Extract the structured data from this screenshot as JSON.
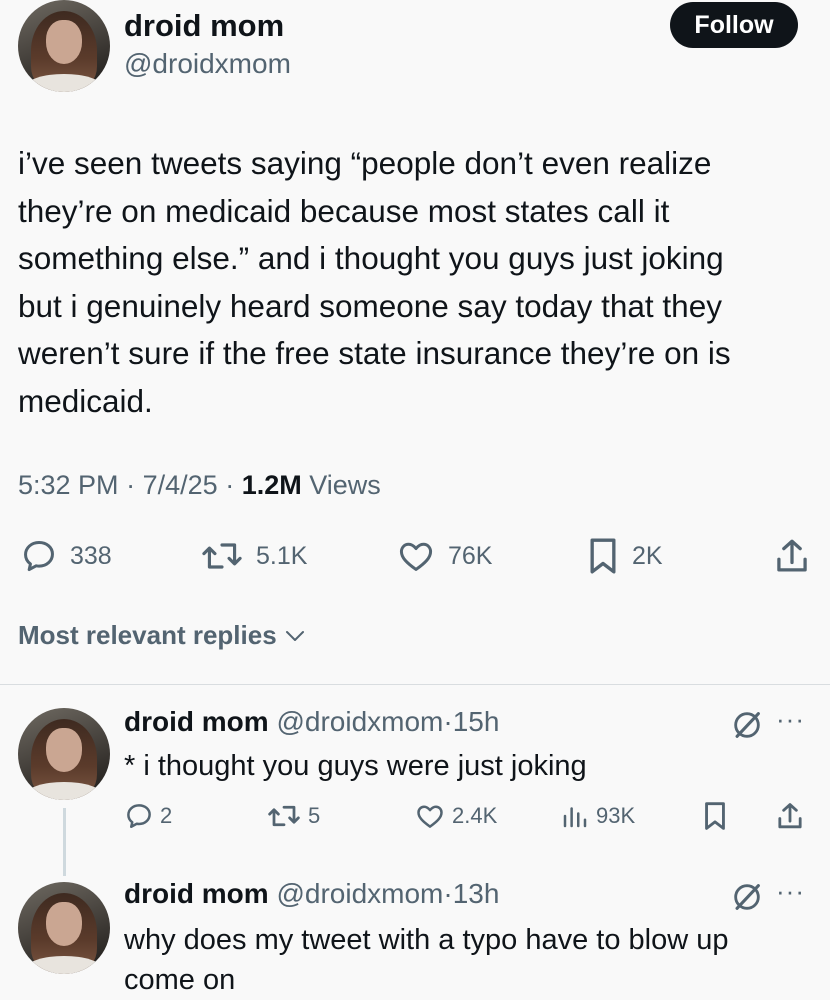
{
  "tweet": {
    "author": {
      "name": "droid mom",
      "handle": "@droidxmom"
    },
    "follow_label": "Follow",
    "text_lines": [
      "i’ve seen tweets saying “people don’t even realize",
      "they’re on medicaid because most states call it",
      "something else.” and i thought you guys just joking",
      "but i genuinely heard someone say today that they",
      "weren’t sure if the free state insurance they’re on is",
      "medicaid."
    ],
    "time": "5:32 PM",
    "date": "7/4/25",
    "sep": "·",
    "views_count": "1.2M",
    "views_label": "Views",
    "stats": {
      "replies": "338",
      "reposts": "5.1K",
      "likes": "76K",
      "bookmarks": "2K"
    }
  },
  "replies_header": "Most relevant replies",
  "replies": [
    {
      "name": "droid mom",
      "handle": "@droidxmom",
      "time": "15h",
      "text": "* i thought you guys were just joking",
      "stats": {
        "replies": "2",
        "reposts": "5",
        "likes": "2.4K",
        "views": "93K"
      }
    },
    {
      "name": "droid mom",
      "handle": "@droidxmom",
      "time": "13h",
      "text": "why does my tweet with a typo have to blow up come on"
    }
  ],
  "colors": {
    "text": "#0f1419",
    "muted": "#536471",
    "background": "#f9f9f9",
    "button": "#0f1419"
  }
}
